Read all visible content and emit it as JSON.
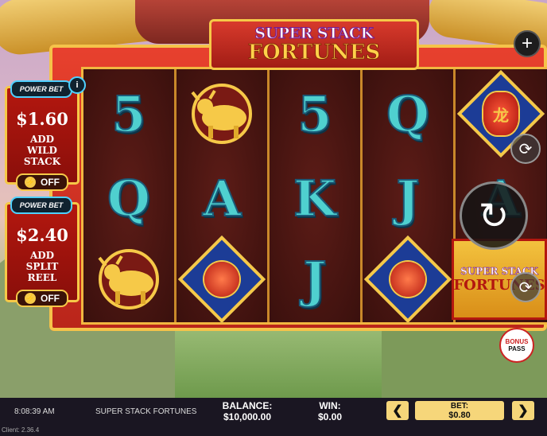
{
  "game": {
    "logo_line1": "SUPER STACK",
    "logo_line2": "FORTUNES"
  },
  "power_bets": [
    {
      "badge": "POWER BET",
      "price": "$1.60",
      "desc": [
        "ADD",
        "WILD",
        "STACK"
      ],
      "toggle": "OFF"
    },
    {
      "badge": "POWER BET",
      "price": "$2.40",
      "desc": [
        "ADD",
        "SPLIT",
        "REEL"
      ],
      "toggle": "OFF"
    }
  ],
  "reels": [
    [
      "5",
      "Q",
      "ox"
    ],
    [
      "ox",
      "A",
      "gourd"
    ],
    [
      "5",
      "K",
      "J"
    ],
    [
      "Q",
      "J",
      "gourd"
    ],
    [
      "lantern",
      "A",
      "logo"
    ]
  ],
  "lantern_char": "龙",
  "side_logo": {
    "line1": "SUPER STACK",
    "line2": "FORTUNES"
  },
  "bonus_pass": {
    "line1": "BONUS",
    "line2": "PASS"
  },
  "icons": {
    "plus": "plus-icon",
    "spin": "spin-icon",
    "autoplay": "autoplay-icon",
    "turbo": "turbo-icon",
    "info": "info-icon"
  },
  "status_bar": {
    "time": "8:08:39 AM",
    "game_title": "SUPER STACK FORTUNES",
    "balance_label": "BALANCE:",
    "balance_value": "$10,000.00",
    "win_label": "WIN:",
    "win_value": "$0.00",
    "bet_label": "BET:",
    "bet_value": "$0.80",
    "client": "Client: 2.36.4"
  },
  "colors": {
    "frame_red": "#d83a2c",
    "gold": "#f6c948",
    "teal_letter": "#4fd0cf",
    "bar_bg": "#1a1622",
    "bet_button": "#f6d67a"
  }
}
